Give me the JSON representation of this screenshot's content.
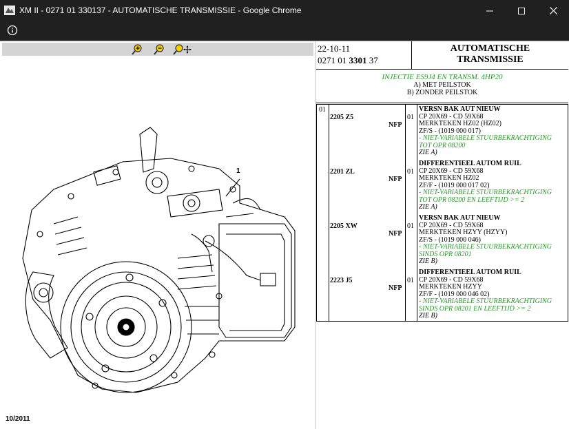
{
  "window": {
    "title": "XM II - 0271 01 330137 - AUTOMATISCHE TRANSMISSIE - Google Chrome",
    "minimize_label": "─",
    "maximize_label": "☐",
    "close_label": "✕"
  },
  "toolbar": {
    "icons": [
      "zoom-in-icon",
      "zoom-out-icon",
      "zoom-pan-icon"
    ]
  },
  "diagram": {
    "callout": "1",
    "date_stamp": "10/2011"
  },
  "header": {
    "date": "22-10-11",
    "ref_prefix": "0271 01",
    "ref_bold": "3301",
    "ref_suffix": "37",
    "title_line1": "AUTOMATISCHE",
    "title_line2": "TRANSMISSIE"
  },
  "subheader": {
    "main": "INJECTIE ES9J4 EN TRANSM. 4HP20",
    "option_a": "A) MET PEILSTOK",
    "option_b": "B) ZONDER PEILSTOK"
  },
  "parts_table": {
    "index": "01",
    "rows": [
      {
        "code": "2205 Z5",
        "nfp": "NFP",
        "qty": "01",
        "title": "VERSN BAK AUT NIEUW",
        "lines": [
          "CP 20X69 - CD 59X68",
          "MERKTEKEN HZ02 (HZ02)",
          "ZF/S - (1019 000 017)"
        ],
        "notes": [
          "- NIET-VARIABELE STUURBEKRACHTIGING",
          "TOT OPR 08200"
        ],
        "zie": "ZIE A)"
      },
      {
        "code": "2201 ZL",
        "nfp": "NFP",
        "qty": "01",
        "title": "DIFFERENTIEEL AUTOM RUIL",
        "lines": [
          "CP 20X69 - CD 59X68",
          "MERKTEKEN HZ02",
          "ZF/F - (1019 000 017 02)"
        ],
        "notes": [
          "- NIET-VARIABELE STUURBEKRACHTIGING",
          "TOT OPR 08200 EN LEEFTIJD >= 2"
        ],
        "zie": "ZIE A)"
      },
      {
        "code": "2205 XW",
        "nfp": "NFP",
        "qty": "01",
        "title": "VERSN BAK AUT NIEUW",
        "lines": [
          "CP 20X69 - CD 59X68",
          "MERKTEKEN HZYY (HZYY)",
          "ZF/S - (1019 000 046)"
        ],
        "notes": [
          "- NIET-VARIABELE STUURBEKRACHTIGING",
          "SINDS OPR 08201"
        ],
        "zie": "ZIE B)"
      },
      {
        "code": "2223 J5",
        "nfp": "NFP",
        "qty": "01",
        "title": "DIFFERENTIEEL AUTOM RUIL",
        "lines": [
          "CP 20X69 - CD 59X68",
          "MERKTEKEN HZYY",
          "ZF/F - (1019 000 046 02)"
        ],
        "notes": [
          "- NIET-VARIABELE STUURBEKRACHTIGING",
          "SINDS OPR 08201 EN LEEFTIJD >= 2"
        ],
        "zie": "ZIE B)"
      }
    ]
  }
}
